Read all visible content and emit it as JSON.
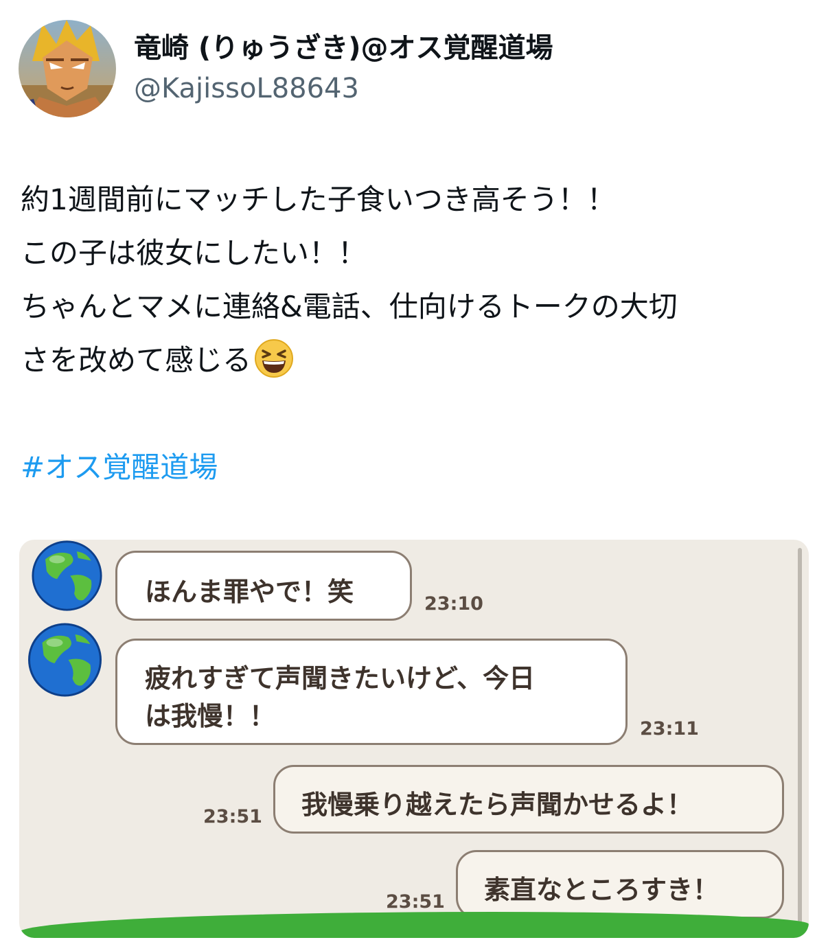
{
  "author": {
    "display_name": "竜崎 (りゅうざき)@オス覚醒道場",
    "handle": "@KajissoL88643"
  },
  "tweet": {
    "lines": [
      "約1週間前にマッチした子食いつき高そう！！",
      "この子は彼女にしたい！！",
      "ちゃんとマメに連絡&電話、仕向けるトークの大切",
      "さを改めて感じる"
    ],
    "emoji": "grinning-squinting-face",
    "hashtag": "#オス覚醒道場"
  },
  "chat": {
    "messages": [
      {
        "from": "other",
        "lines": [
          "ほんま罪やで！笑"
        ],
        "time": "23:10"
      },
      {
        "from": "other",
        "lines": [
          "疲れすぎて声聞きたいけど、今日",
          "は我慢！！"
        ],
        "time": "23:11"
      },
      {
        "from": "me",
        "lines": [
          "我慢乗り越えたら声聞かせるよ！"
        ],
        "time": "23:51"
      },
      {
        "from": "me",
        "lines": [
          "素直なところすき！"
        ],
        "time": "23:51"
      }
    ]
  },
  "colors": {
    "hashtag": "#1d9bf0",
    "handle": "#536471",
    "chat_background": "#efebe4",
    "bubble_border": "#8c7e72"
  }
}
